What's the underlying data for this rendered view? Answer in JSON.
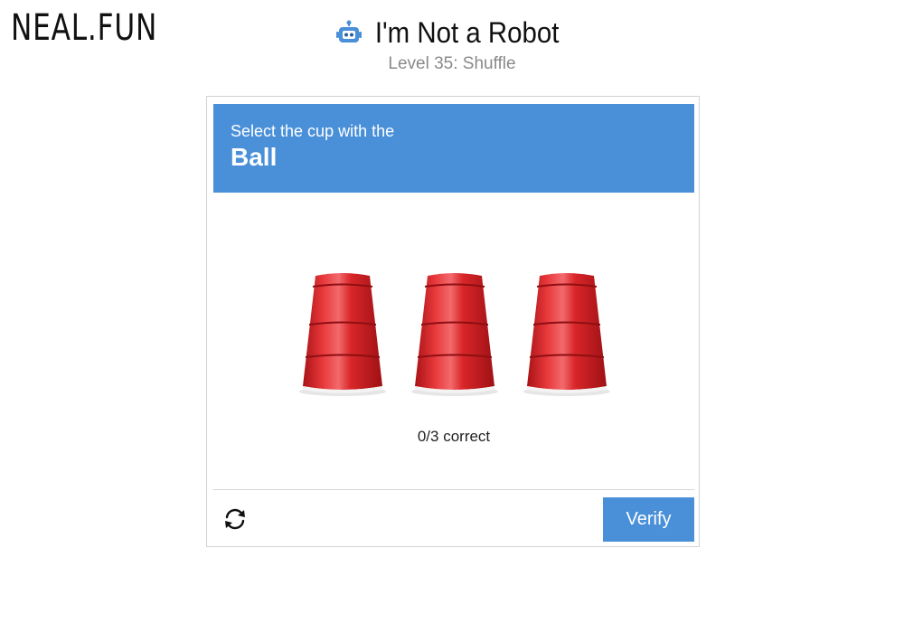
{
  "brand": {
    "logo_text": "NEAL.FUN"
  },
  "header": {
    "icon": "robot-icon",
    "title": "I'm Not a Robot",
    "level": "Level 35: Shuffle"
  },
  "captcha": {
    "prompt_line": "Select the cup with the",
    "prompt_target": "Ball",
    "cups": [
      {
        "icon": "red-cup"
      },
      {
        "icon": "red-cup"
      },
      {
        "icon": "red-cup"
      }
    ],
    "score_text": "0/3 correct",
    "reload_icon": "refresh-icon",
    "verify_label": "Verify"
  },
  "colors": {
    "accent": "#4a90d9",
    "cup": "#d9262a",
    "subtitle": "#8a8a8a",
    "border": "#d3d3d3"
  }
}
